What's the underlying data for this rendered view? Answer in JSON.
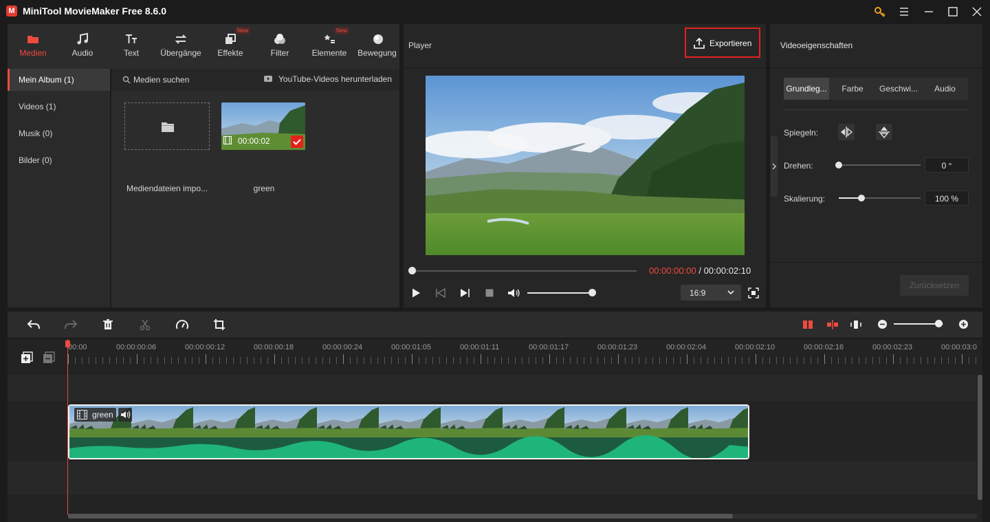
{
  "app": {
    "title": "MiniTool MovieMaker Free 8.6.0",
    "logo_text": "M"
  },
  "media_tabs": [
    {
      "label": "Medien",
      "icon": "folder-icon",
      "active": true
    },
    {
      "label": "Audio",
      "icon": "music-note-icon"
    },
    {
      "label": "Text",
      "icon": "text-icon"
    },
    {
      "label": "Übergänge",
      "icon": "transition-icon"
    },
    {
      "label": "Effekte",
      "icon": "effects-icon",
      "badge": "New"
    },
    {
      "label": "Filter",
      "icon": "filter-icon"
    },
    {
      "label": "Elemente",
      "icon": "elements-icon",
      "badge": "New"
    },
    {
      "label": "Bewegung",
      "icon": "motion-icon"
    }
  ],
  "media_sidebar": [
    {
      "label": "Mein Album (1)",
      "active": true
    },
    {
      "label": "Videos (1)"
    },
    {
      "label": "Musik (0)"
    },
    {
      "label": "Bilder (0)"
    }
  ],
  "media_toolbar": {
    "search_label": "Medien suchen",
    "youtube_label": "YouTube-Videos herunterladen"
  },
  "media_items": [
    {
      "label": "Mediendateien impo...",
      "type": "import"
    },
    {
      "label": "green",
      "duration": "00:00:02",
      "selected": true
    }
  ],
  "player": {
    "title": "Player",
    "export_label": "Exportieren",
    "current_time": "00:00:00:00",
    "separator": "/",
    "total_time": "00:00:02:10",
    "aspect_ratio": "16:9",
    "progress": 0,
    "volume": 1.0
  },
  "properties": {
    "title": "Videoeigenschaften",
    "tabs": [
      "Grundleg...",
      "Farbe",
      "Geschwi...",
      "Audio"
    ],
    "active_tab": 0,
    "mirror_label": "Spiegeln:",
    "rotate_label": "Drehen:",
    "rotate_value": "0 °",
    "rotate_level": 0,
    "scale_label": "Skalierung:",
    "scale_value": "100 %",
    "scale_level": 0.28,
    "reset_label": "Zurücksetzen"
  },
  "timeline": {
    "ruler_ticks": [
      "00:00",
      "00:00:00:06",
      "00:00:00:12",
      "00:00:00:18",
      "00:00:00:24",
      "00:00:01:05",
      "00:00:01:11",
      "00:00:01:17",
      "00:00:01:23",
      "00:00:02:04",
      "00:00:02:10",
      "00:00:02:16",
      "00:00:02:23",
      "00:00:03:0"
    ],
    "clip_name": "green",
    "zoom_level": 0.9,
    "colors": {
      "accent": "#ee4b3f",
      "audio_wave": "#1fb57a",
      "export_border": "#e5211c"
    }
  }
}
